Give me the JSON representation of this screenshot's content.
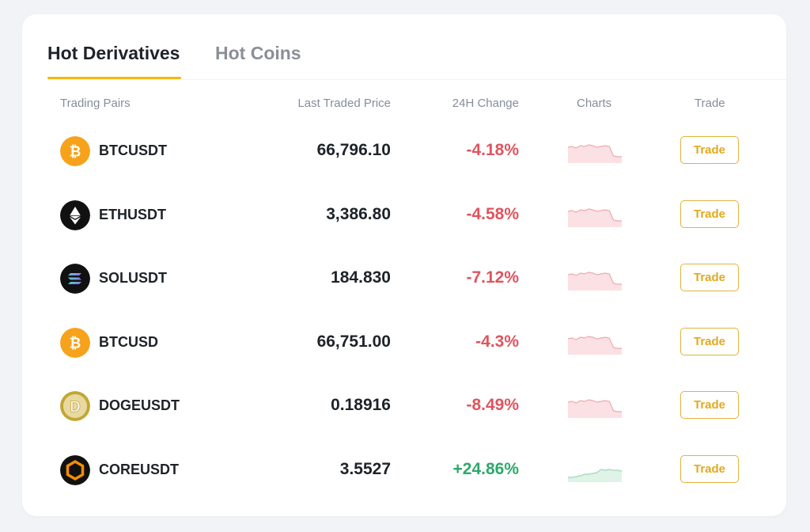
{
  "tabs": [
    {
      "label": "Hot Derivatives",
      "active": true
    },
    {
      "label": "Hot Coins",
      "active": false
    }
  ],
  "columns": {
    "pair": "Trading Pairs",
    "price": "Last Traded Price",
    "change": "24H Change",
    "charts": "Charts",
    "trade": "Trade"
  },
  "rows": [
    {
      "icon": "bitcoin-icon",
      "pair": "BTCUSDT",
      "price": "66,796.10",
      "change": "-4.18%",
      "trend": "down",
      "trade_label": "Trade"
    },
    {
      "icon": "ethereum-icon",
      "pair": "ETHUSDT",
      "price": "3,386.80",
      "change": "-4.58%",
      "trend": "down",
      "trade_label": "Trade"
    },
    {
      "icon": "solana-icon",
      "pair": "SOLUSDT",
      "price": "184.830",
      "change": "-7.12%",
      "trend": "down",
      "trade_label": "Trade"
    },
    {
      "icon": "bitcoin-icon",
      "pair": "BTCUSD",
      "price": "66,751.00",
      "change": "-4.3%",
      "trend": "down",
      "trade_label": "Trade"
    },
    {
      "icon": "dogecoin-icon",
      "pair": "DOGEUSDT",
      "price": "0.18916",
      "change": "-8.49%",
      "trend": "down",
      "trade_label": "Trade"
    },
    {
      "icon": "core-icon",
      "pair": "COREUSDT",
      "price": "3.5527",
      "change": "+24.86%",
      "trend": "up",
      "trade_label": "Trade"
    }
  ],
  "colors": {
    "accent": "#f0b90b",
    "negative": "#e0545e",
    "positive": "#2ea86b"
  }
}
